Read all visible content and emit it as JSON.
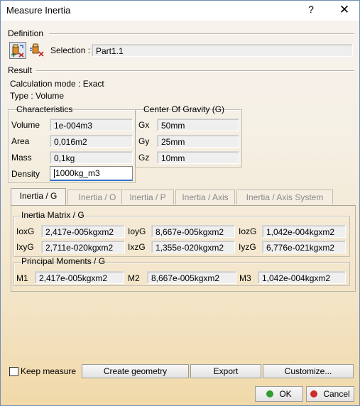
{
  "window": {
    "title": "Measure Inertia",
    "help": "?",
    "close": "✕"
  },
  "definition": {
    "label": "Definition",
    "selection_label": "Selection :",
    "selection_value": "Part1.1"
  },
  "result": {
    "label": "Result",
    "calc_mode": "Calculation mode : Exact",
    "type": "Type : Volume"
  },
  "characteristics": {
    "title": "Characteristics",
    "rows": [
      {
        "label": "Volume",
        "value": "1e-004m3"
      },
      {
        "label": "Area",
        "value": "0,016m2"
      },
      {
        "label": "Mass",
        "value": "0,1kg"
      },
      {
        "label": "Density",
        "value": "1000kg_m3"
      }
    ]
  },
  "cog": {
    "title": "Center Of Gravity (G)",
    "rows": [
      {
        "label": "Gx",
        "value": "50mm"
      },
      {
        "label": "Gy",
        "value": "25mm"
      },
      {
        "label": "Gz",
        "value": "10mm"
      }
    ]
  },
  "tabs": [
    "Inertia / G",
    "Inertia / O",
    "Inertia / P",
    "Inertia / Axis",
    "Inertia / Axis System"
  ],
  "active_tab": 0,
  "inertia_matrix": {
    "title": "Inertia Matrix / G",
    "row1": [
      {
        "label": "IoxG",
        "value": "2,417e-005kgxm2"
      },
      {
        "label": "IoyG",
        "value": "8,667e-005kgxm2"
      },
      {
        "label": "IozG",
        "value": "1,042e-004kgxm2"
      }
    ],
    "row2": [
      {
        "label": "IxyG",
        "value": "2,711e-020kgxm2"
      },
      {
        "label": "IxzG",
        "value": "1,355e-020kgxm2"
      },
      {
        "label": "IyzG",
        "value": "6,776e-021kgxm2"
      }
    ]
  },
  "principal_moments": {
    "title": "Principal Moments / G",
    "items": [
      {
        "label": "M1",
        "value": "2,417e-005kgxm2"
      },
      {
        "label": "M2",
        "value": "8,667e-005kgxm2"
      },
      {
        "label": "M3",
        "value": "1,042e-004kgxm2"
      }
    ]
  },
  "footer": {
    "keep_measure": "Keep measure",
    "create_geometry": "Create geometry",
    "export": "Export",
    "customize": "Customize...",
    "ok": "OK",
    "cancel": "Cancel"
  },
  "colors": {
    "ok_dot": "#2e9e2e",
    "cancel_dot": "#d02a2a",
    "edit_underline": "#3b73c9"
  }
}
